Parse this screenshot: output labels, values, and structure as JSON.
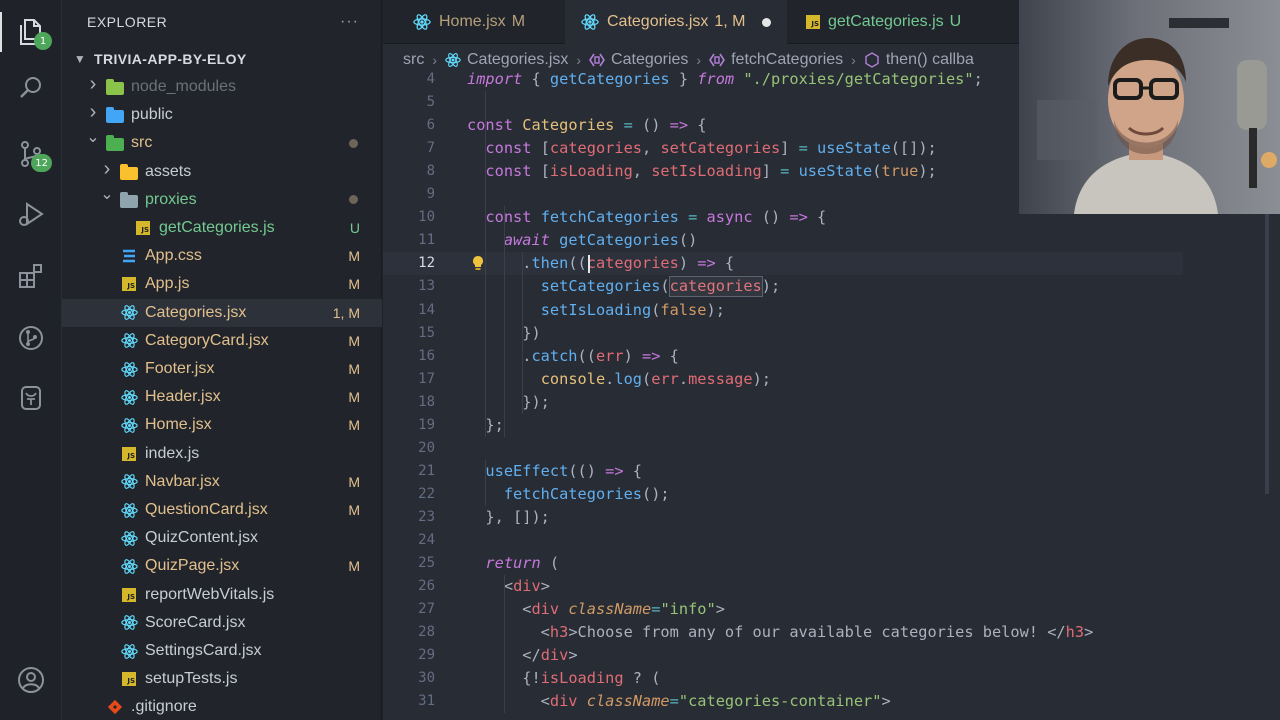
{
  "activity_bar": {
    "explorer_badge": "1",
    "scm_badge": "12"
  },
  "sidebar": {
    "title": "EXPLORER",
    "more": "···",
    "project": "TRIVIA-APP-BY-ELOY",
    "items": [
      {
        "name": "node_modules",
        "type": "folder",
        "depth": 1,
        "expanded": false,
        "badge": "",
        "color": "#6a7178",
        "dot": false,
        "icon_color": "#8bc34a"
      },
      {
        "name": "public",
        "type": "folder",
        "depth": 1,
        "expanded": false,
        "badge": "",
        "color": "#c8ccd4",
        "dot": false,
        "icon_color": "#42a5f5"
      },
      {
        "name": "src",
        "type": "folder",
        "depth": 1,
        "expanded": true,
        "badge": "",
        "color": "#e2c08d",
        "dot": true,
        "icon_color": "#4caf50"
      },
      {
        "name": "assets",
        "type": "folder",
        "depth": 2,
        "expanded": false,
        "badge": "",
        "color": "#c8ccd4",
        "dot": false,
        "icon_color": "#fbc02d"
      },
      {
        "name": "proxies",
        "type": "folder",
        "depth": 2,
        "expanded": true,
        "badge": "",
        "color": "#73c991",
        "dot": true,
        "icon_color": "#90a4ae"
      },
      {
        "name": "getCategories.js",
        "type": "js",
        "depth": 3,
        "badge": "U",
        "color": "#73c991"
      },
      {
        "name": "App.css",
        "type": "css",
        "depth": 2,
        "badge": "M",
        "color": "#e2c08d"
      },
      {
        "name": "App.js",
        "type": "js",
        "depth": 2,
        "badge": "M",
        "color": "#e2c08d"
      },
      {
        "name": "Categories.jsx",
        "type": "jsx",
        "depth": 2,
        "badge": "1, M",
        "color": "#e2c08d",
        "selected": true
      },
      {
        "name": "CategoryCard.jsx",
        "type": "jsx",
        "depth": 2,
        "badge": "M",
        "color": "#e2c08d"
      },
      {
        "name": "Footer.jsx",
        "type": "jsx",
        "depth": 2,
        "badge": "M",
        "color": "#e2c08d"
      },
      {
        "name": "Header.jsx",
        "type": "jsx",
        "depth": 2,
        "badge": "M",
        "color": "#e2c08d"
      },
      {
        "name": "Home.jsx",
        "type": "jsx",
        "depth": 2,
        "badge": "M",
        "color": "#e2c08d"
      },
      {
        "name": "index.js",
        "type": "js",
        "depth": 2,
        "badge": "",
        "color": "#c8ccd4"
      },
      {
        "name": "Navbar.jsx",
        "type": "jsx",
        "depth": 2,
        "badge": "M",
        "color": "#e2c08d"
      },
      {
        "name": "QuestionCard.jsx",
        "type": "jsx",
        "depth": 2,
        "badge": "M",
        "color": "#e2c08d"
      },
      {
        "name": "QuizContent.jsx",
        "type": "jsx",
        "depth": 2,
        "badge": "",
        "color": "#c8ccd4"
      },
      {
        "name": "QuizPage.jsx",
        "type": "jsx",
        "depth": 2,
        "badge": "M",
        "color": "#e2c08d"
      },
      {
        "name": "reportWebVitals.js",
        "type": "js",
        "depth": 2,
        "badge": "",
        "color": "#c8ccd4"
      },
      {
        "name": "ScoreCard.jsx",
        "type": "jsx",
        "depth": 2,
        "badge": "",
        "color": "#c8ccd4"
      },
      {
        "name": "SettingsCard.jsx",
        "type": "jsx",
        "depth": 2,
        "badge": "",
        "color": "#c8ccd4"
      },
      {
        "name": "setupTests.js",
        "type": "js",
        "depth": 2,
        "badge": "",
        "color": "#c8ccd4"
      },
      {
        "name": ".gitignore",
        "type": "git",
        "depth": 1,
        "badge": "",
        "color": "#c8ccd4"
      }
    ]
  },
  "tabs": [
    {
      "label": "Home.jsx",
      "status": "M",
      "type": "jsx",
      "active": false,
      "color": "#e2c08d"
    },
    {
      "label": "Categories.jsx",
      "status": "1, M",
      "type": "jsx",
      "active": true,
      "color": "#e2c08d",
      "unsaved": true
    },
    {
      "label": "getCategories.js",
      "status": "U",
      "type": "js",
      "active": false,
      "color": "#73c991"
    }
  ],
  "breadcrumbs": [
    "src",
    "Categories.jsx",
    "Categories",
    "fetchCategories",
    "then() callba"
  ],
  "code": {
    "current_line": "12",
    "lines": [
      {
        "n": "4",
        "tokens": [
          [
            "ki",
            "import"
          ],
          [
            "t",
            " { "
          ],
          [
            "f",
            "getCategories"
          ],
          [
            "t",
            " } "
          ],
          [
            "ki",
            "from"
          ],
          [
            "t",
            " "
          ],
          [
            "s",
            "\"./proxies/getCategories\""
          ],
          [
            "t",
            ";"
          ]
        ]
      },
      {
        "n": "5",
        "tokens": []
      },
      {
        "n": "6",
        "tokens": [
          [
            "k",
            "const"
          ],
          [
            "t",
            " "
          ],
          [
            "y",
            "Categories"
          ],
          [
            "t",
            " "
          ],
          [
            "c",
            "="
          ],
          [
            "t",
            " () "
          ],
          [
            "k",
            "=>"
          ],
          [
            "t",
            " {"
          ]
        ]
      },
      {
        "n": "7",
        "tokens": [
          [
            "t",
            "  "
          ],
          [
            "k",
            "const"
          ],
          [
            "t",
            " ["
          ],
          [
            "v",
            "categories"
          ],
          [
            "t",
            ", "
          ],
          [
            "v",
            "setCategories"
          ],
          [
            "t",
            "] "
          ],
          [
            "c",
            "="
          ],
          [
            "t",
            " "
          ],
          [
            "f",
            "useState"
          ],
          [
            "t",
            "([]);"
          ]
        ]
      },
      {
        "n": "8",
        "tokens": [
          [
            "t",
            "  "
          ],
          [
            "k",
            "const"
          ],
          [
            "t",
            " ["
          ],
          [
            "v",
            "isLoading"
          ],
          [
            "t",
            ", "
          ],
          [
            "v",
            "setIsLoading"
          ],
          [
            "t",
            "] "
          ],
          [
            "c",
            "="
          ],
          [
            "t",
            " "
          ],
          [
            "f",
            "useState"
          ],
          [
            "t",
            "("
          ],
          [
            "n",
            "true"
          ],
          [
            "t",
            ");"
          ]
        ]
      },
      {
        "n": "9",
        "tokens": []
      },
      {
        "n": "10",
        "tokens": [
          [
            "t",
            "  "
          ],
          [
            "k",
            "const"
          ],
          [
            "t",
            " "
          ],
          [
            "f",
            "fetchCategories"
          ],
          [
            "t",
            " "
          ],
          [
            "c",
            "="
          ],
          [
            "t",
            " "
          ],
          [
            "k",
            "async"
          ],
          [
            "t",
            " () "
          ],
          [
            "k",
            "=>"
          ],
          [
            "t",
            " {"
          ]
        ]
      },
      {
        "n": "11",
        "tokens": [
          [
            "t",
            "    "
          ],
          [
            "ki",
            "await"
          ],
          [
            "t",
            " "
          ],
          [
            "f",
            "getCategories"
          ],
          [
            "t",
            "()"
          ]
        ]
      },
      {
        "n": "12",
        "tokens": [
          [
            "t",
            "      ."
          ],
          [
            "f",
            "then"
          ],
          [
            "t",
            "(("
          ],
          [
            "v",
            "categories"
          ],
          [
            "t",
            ") "
          ],
          [
            "k",
            "=>"
          ],
          [
            "t",
            " {"
          ]
        ]
      },
      {
        "n": "13",
        "tokens": [
          [
            "t",
            "        "
          ],
          [
            "f",
            "setCategories"
          ],
          [
            "t",
            "("
          ],
          [
            "v",
            "categories"
          ],
          [
            "t",
            ");"
          ]
        ]
      },
      {
        "n": "14",
        "tokens": [
          [
            "t",
            "        "
          ],
          [
            "f",
            "setIsLoading"
          ],
          [
            "t",
            "("
          ],
          [
            "n",
            "false"
          ],
          [
            "t",
            ");"
          ]
        ]
      },
      {
        "n": "15",
        "tokens": [
          [
            "t",
            "      })"
          ]
        ]
      },
      {
        "n": "16",
        "tokens": [
          [
            "t",
            "      ."
          ],
          [
            "f",
            "catch"
          ],
          [
            "t",
            "(("
          ],
          [
            "v",
            "err"
          ],
          [
            "t",
            ") "
          ],
          [
            "k",
            "=>"
          ],
          [
            "t",
            " {"
          ]
        ]
      },
      {
        "n": "17",
        "tokens": [
          [
            "t",
            "        "
          ],
          [
            "y",
            "console"
          ],
          [
            "t",
            "."
          ],
          [
            "f",
            "log"
          ],
          [
            "t",
            "("
          ],
          [
            "v",
            "err"
          ],
          [
            "t",
            "."
          ],
          [
            "v",
            "message"
          ],
          [
            "t",
            ");"
          ]
        ]
      },
      {
        "n": "18",
        "tokens": [
          [
            "t",
            "      });"
          ]
        ]
      },
      {
        "n": "19",
        "tokens": [
          [
            "t",
            "  };"
          ]
        ]
      },
      {
        "n": "20",
        "tokens": []
      },
      {
        "n": "21",
        "tokens": [
          [
            "t",
            "  "
          ],
          [
            "f",
            "useEffect"
          ],
          [
            "t",
            "(() "
          ],
          [
            "k",
            "=>"
          ],
          [
            "t",
            " {"
          ]
        ]
      },
      {
        "n": "22",
        "tokens": [
          [
            "t",
            "    "
          ],
          [
            "f",
            "fetchCategories"
          ],
          [
            "t",
            "();"
          ]
        ]
      },
      {
        "n": "23",
        "tokens": [
          [
            "t",
            "  }, []);"
          ]
        ]
      },
      {
        "n": "24",
        "tokens": []
      },
      {
        "n": "25",
        "tokens": [
          [
            "t",
            "  "
          ],
          [
            "ki",
            "return"
          ],
          [
            "t",
            " ("
          ]
        ]
      },
      {
        "n": "26",
        "tokens": [
          [
            "t",
            "    <"
          ],
          [
            "v",
            "div"
          ],
          [
            "t",
            ">"
          ]
        ]
      },
      {
        "n": "27",
        "tokens": [
          [
            "t",
            "      <"
          ],
          [
            "v",
            "div"
          ],
          [
            "t",
            " "
          ],
          [
            "at",
            "className"
          ],
          [
            "c",
            "="
          ],
          [
            "s",
            "\"info\""
          ],
          [
            "t",
            ">"
          ]
        ]
      },
      {
        "n": "28",
        "tokens": [
          [
            "t",
            "        <"
          ],
          [
            "v",
            "h3"
          ],
          [
            "t",
            ">Choose from any of our available categories below! </"
          ],
          [
            "v",
            "h3"
          ],
          [
            "t",
            ">"
          ]
        ]
      },
      {
        "n": "29",
        "tokens": [
          [
            "t",
            "      </"
          ],
          [
            "v",
            "div"
          ],
          [
            "t",
            ">"
          ]
        ]
      },
      {
        "n": "30",
        "tokens": [
          [
            "t",
            "      {!"
          ],
          [
            "v",
            "isLoading"
          ],
          [
            "t",
            " ? ("
          ]
        ]
      },
      {
        "n": "31",
        "tokens": [
          [
            "t",
            "        <"
          ],
          [
            "v",
            "div"
          ],
          [
            "t",
            " "
          ],
          [
            "at",
            "className"
          ],
          [
            "c",
            "="
          ],
          [
            "s",
            "\"categories-container\""
          ],
          [
            "t",
            ">"
          ]
        ]
      }
    ]
  }
}
